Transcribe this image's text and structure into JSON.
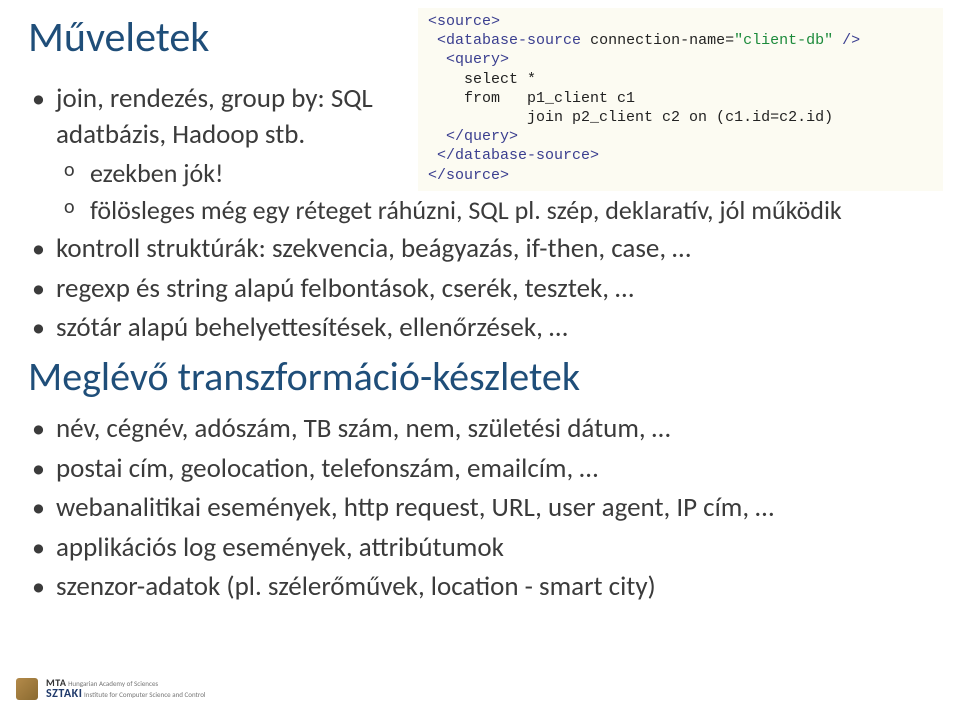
{
  "heading1": "Műveletek",
  "list1": {
    "item1": "join, rendezés, group by: SQL adatbázis, Hadoop stb.",
    "sub1a": "ezekben jók!",
    "sub1b": "fölösleges még egy réteget ráhúzni, SQL pl. szép, deklaratív, jól működik",
    "item2": "kontroll struktúrák: szekvencia, beágyazás, if-then, case, …",
    "item3": "regexp és string alapú felbontások, cserék, tesztek, …",
    "item4": "szótár alapú behelyettesítések, ellenőrzések, …"
  },
  "heading2": "Meglévő transzformáció-készletek",
  "list2": {
    "item1": "név, cégnév, adószám, TB szám, nem, születési dátum, …",
    "item2": "postai cím, geolocation, telefonszám, emailcím, …",
    "item3": "webanalitikai események, http request, URL, user agent, IP cím, …",
    "item4": "applikációs log események, attribútumok",
    "item5": "szenzor-adatok (pl. szélerőművek, location - smart city)"
  },
  "logo": {
    "mta": "MTA",
    "mta_sub": "Hungarian Academy of Sciences",
    "sztaki": "SZTAKI",
    "sztaki_sub": "Institute for Computer Science and Control"
  }
}
